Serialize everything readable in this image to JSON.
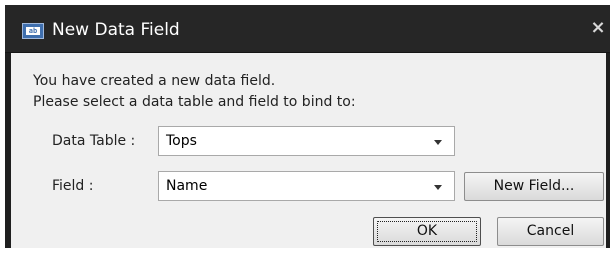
{
  "dialog": {
    "title": "New Data Field",
    "icon_text": "ab",
    "close_glyph": "×",
    "message_line1": "You have created a new data field.",
    "message_line2": "Please select a data table and field to bind to:",
    "data_table": {
      "label": "Data Table :",
      "value": "Tops"
    },
    "field": {
      "label": "Field :",
      "value": "Name"
    },
    "new_field_button": "New Field...",
    "ok_button": "OK",
    "cancel_button": "Cancel"
  }
}
